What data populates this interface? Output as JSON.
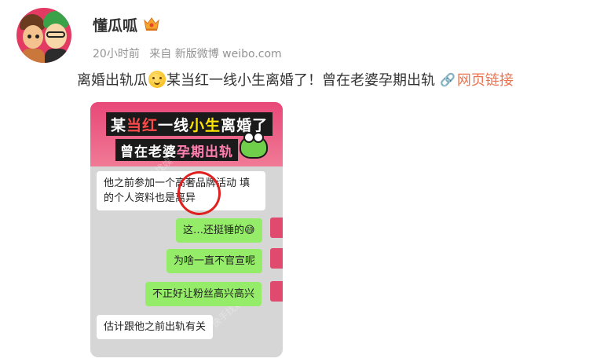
{
  "post": {
    "username": "懂瓜呱",
    "time": "20小时前",
    "source": "来自 新版微博 weibo.com",
    "text_part1": "离婚出轨瓜",
    "text_part2": "某当红一线小生离婚了！曾在老婆孕期出轨",
    "web_link": "网页链接",
    "link_icon": "🔗"
  },
  "image": {
    "title_line1": [
      "某",
      "当红",
      "一线",
      "小生",
      "离婚了"
    ],
    "title_line2": [
      "曾在老婆",
      "孕期出轨"
    ],
    "watermark": "快手找娱",
    "messages": [
      {
        "side": "left",
        "text_line1": "他之前参加一个高奢品牌活动 填",
        "text_line2": "的个人资料也是离异"
      },
      {
        "side": "right",
        "text": "这…还挺锤的😅"
      },
      {
        "side": "right",
        "text": "为啥一直不官宣呢"
      },
      {
        "side": "right",
        "text": "不正好让粉丝高兴高兴"
      },
      {
        "side": "left",
        "text": "估计跟他之前出轨有关"
      }
    ]
  },
  "colors": {
    "link": "#eb7350",
    "meta": "#939393",
    "bubble_right": "#95ec69",
    "card_header": "#e84878"
  }
}
